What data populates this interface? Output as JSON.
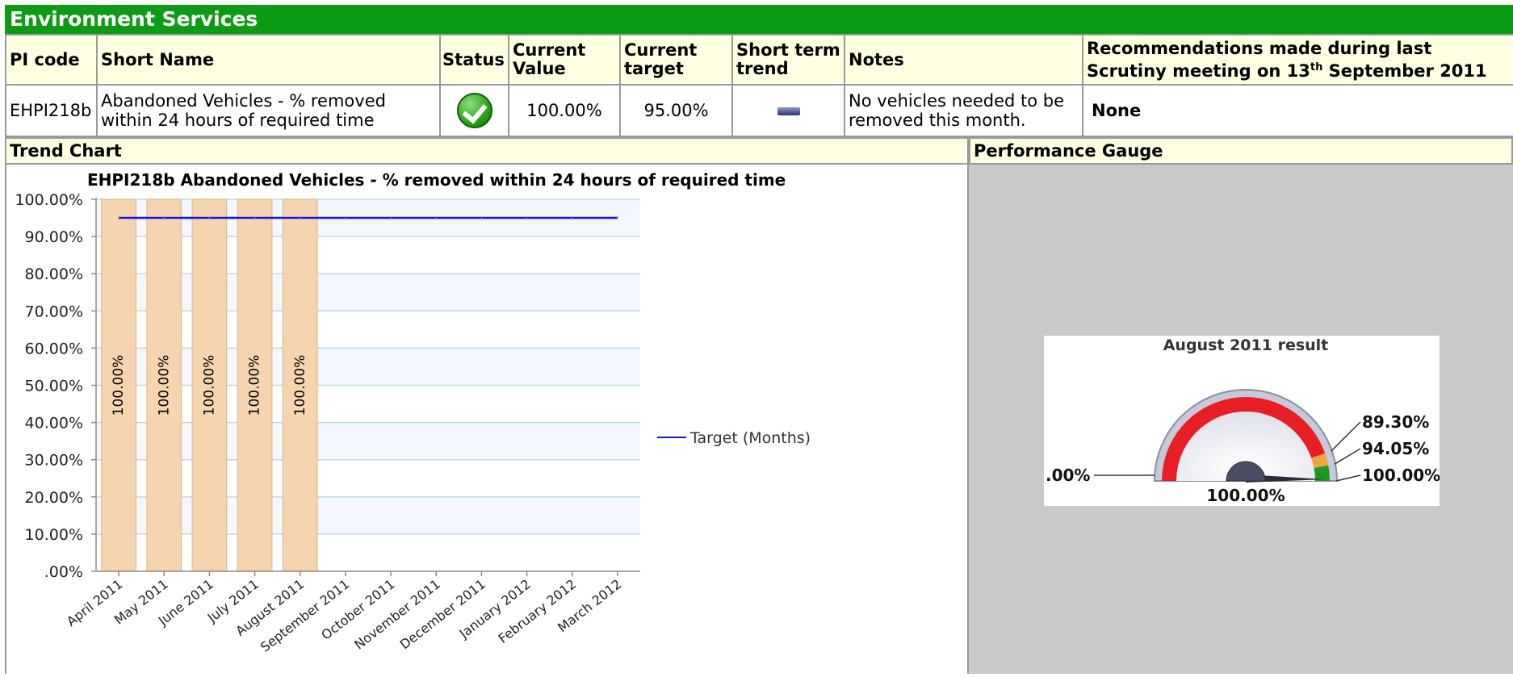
{
  "banner": {
    "title": "Environment Services"
  },
  "table": {
    "headers": {
      "pi_code": "PI code",
      "short_name": "Short Name",
      "status": "Status",
      "current_value": "Current Value",
      "current_target": "Current target",
      "short_term_trend": "Short term trend",
      "notes": "Notes",
      "recommendations_line1": "Recommendations made during last",
      "recommendations_line2_pre": "Scrutiny meeting on 13",
      "recommendations_sup": "th",
      "recommendations_line2_post": " September 2011"
    },
    "row": {
      "pi_code": "EHPI218b",
      "short_name": "Abandoned Vehicles - % removed within 24 hours of required time",
      "status_icon": "green-check-icon",
      "current_value": "100.00%",
      "current_target": "95.00%",
      "trend_icon": "no-change-bar-icon",
      "notes": "No vehicles needed to be removed this month.",
      "recommendations": "None"
    }
  },
  "sections": {
    "trend_chart": "Trend Chart",
    "performance_gauge": "Performance Gauge"
  },
  "chart_data": [
    {
      "type": "bar",
      "title": "EHPI218b Abandoned Vehicles - % removed within 24 hours of required time",
      "categories": [
        "April 2011",
        "May 2011",
        "June 2011",
        "July 2011",
        "August 2011",
        "September 2011",
        "October 2011",
        "November 2011",
        "December 2011",
        "January 2012",
        "February 2012",
        "March 2012"
      ],
      "series": [
        {
          "kind": "bar",
          "values": [
            100,
            100,
            100,
            100,
            100,
            null,
            null,
            null,
            null,
            null,
            null,
            null
          ],
          "labels": [
            "100.00%",
            "100.00%",
            "100.00%",
            "100.00%",
            "100.00%"
          ]
        },
        {
          "name": "Target (Months)",
          "kind": "line",
          "values": [
            95,
            95,
            95,
            95,
            95,
            95,
            95,
            95,
            95,
            95,
            95,
            95
          ]
        }
      ],
      "y_ticks": [
        "100.00%",
        "90.00%",
        "80.00%",
        "70.00%",
        "60.00%",
        "50.00%",
        "40.00%",
        "30.00%",
        "20.00%",
        "10.00%",
        ".00%"
      ],
      "ylim": [
        0,
        100
      ],
      "grid": true,
      "legend_position": "right",
      "colors": {
        "bar": "#f5d5b0",
        "bar_edge": "#e4b487",
        "target_line": "#1515e6",
        "band": "#f4f7fd",
        "grid": "#bcdbe6"
      }
    },
    {
      "type": "gauge",
      "title": "August 2011 result",
      "value": 100,
      "value_label": "100.00%",
      "min_label": ".00%",
      "thresholds": [
        {
          "value": 89.3,
          "label": "89.30%",
          "color": "#f7a33a"
        },
        {
          "value": 94.05,
          "label": "94.05%",
          "color": "#1c9b24"
        },
        {
          "value": 100,
          "label": "100.00%"
        }
      ],
      "min": 0,
      "max": 100,
      "colors": {
        "red": "#e81e25",
        "amber": "#f7a33a",
        "green": "#1c9b24"
      }
    }
  ]
}
